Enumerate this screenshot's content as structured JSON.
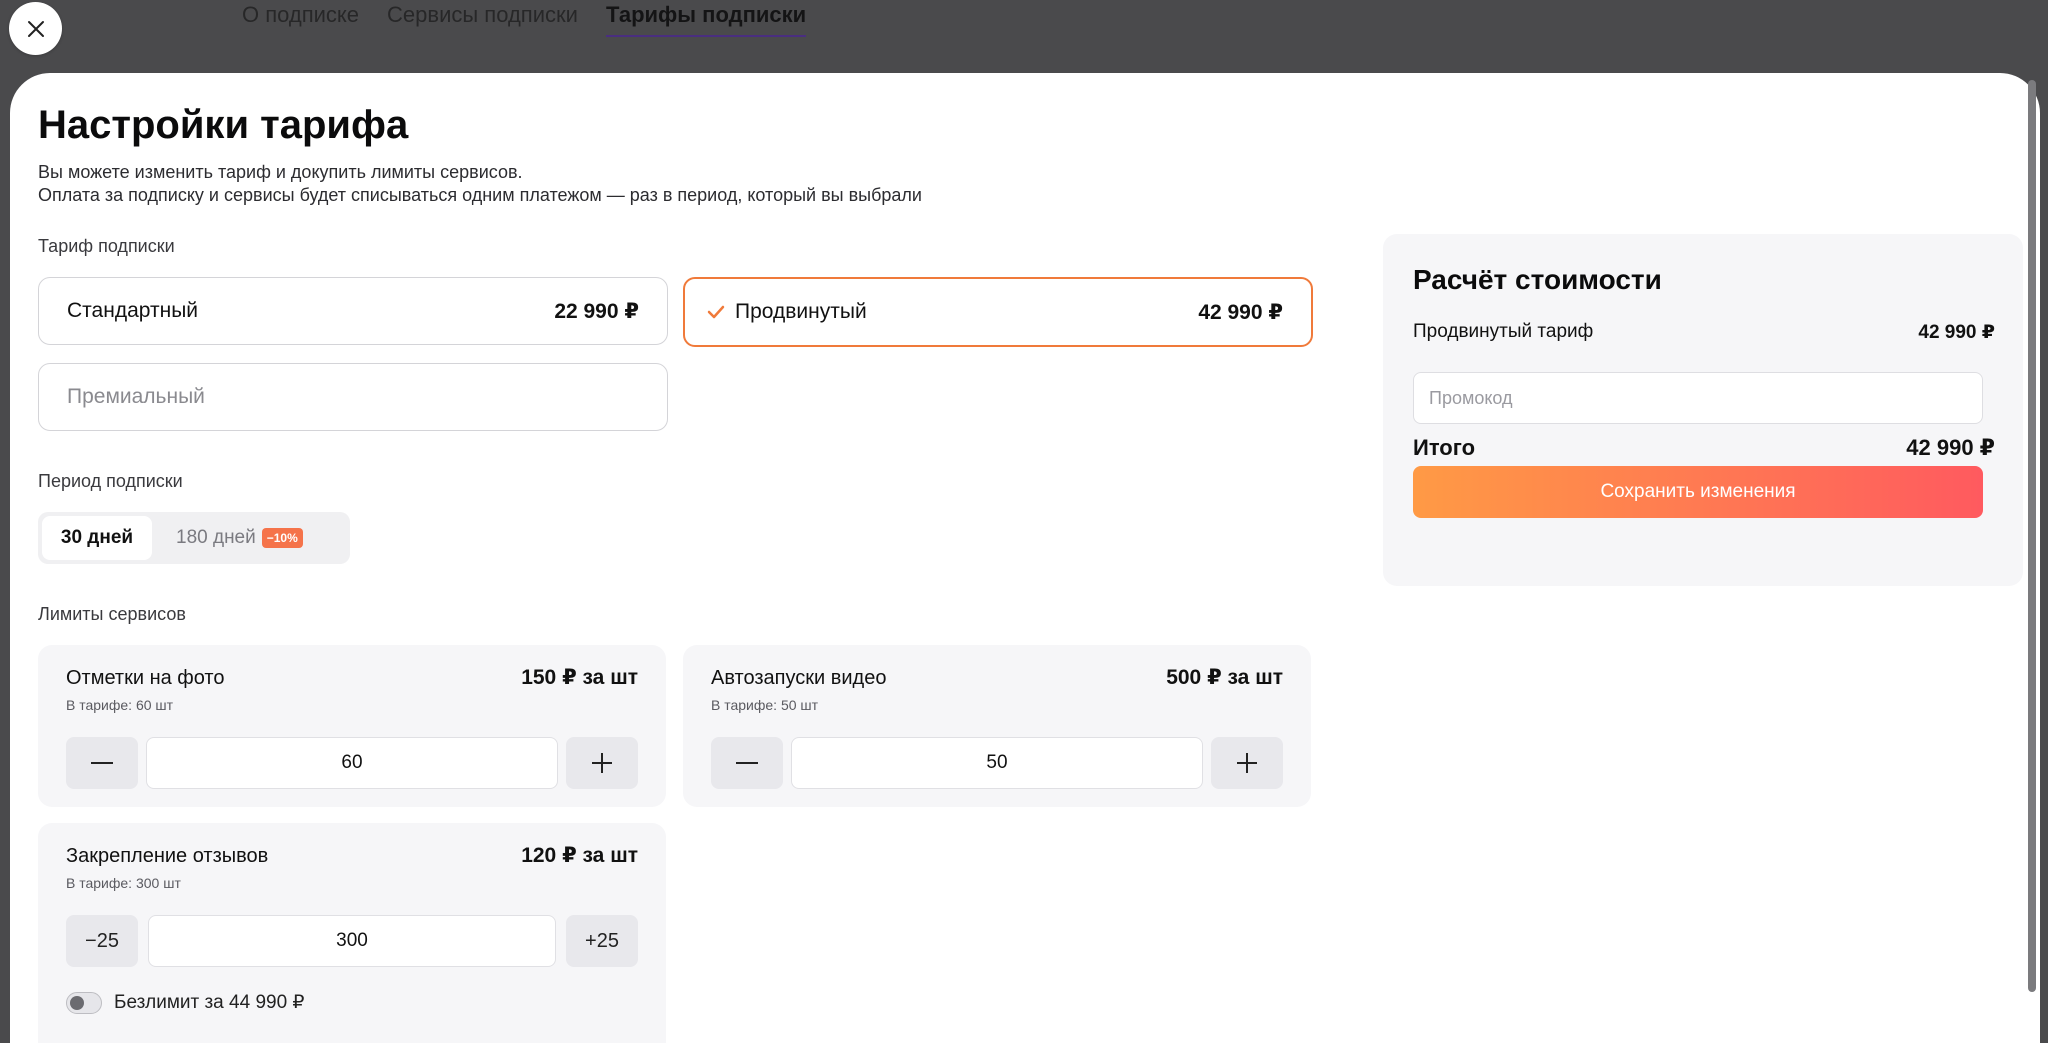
{
  "background": {
    "tabs": [
      {
        "label": "О подписке"
      },
      {
        "label": "Сервисы подписки"
      },
      {
        "label": "Тарифы подписки",
        "active": true
      }
    ]
  },
  "modal": {
    "title": "Настройки тарифа",
    "subtitle_line1": "Вы можете изменить тариф и докупить лимиты сервисов.",
    "subtitle_line2": "Оплата за подписку и сервисы будет списываться одним платежом — раз в период, который вы выбрали",
    "close_icon": "close-icon"
  },
  "tariff": {
    "label": "Тариф подписки",
    "options": [
      {
        "name": "Стандартный",
        "price": "22 990 ₽",
        "selected": false
      },
      {
        "name": "Продвинутый",
        "price": "42 990 ₽",
        "selected": true
      },
      {
        "name": "Премиальный",
        "price": "",
        "selected": false
      }
    ]
  },
  "period": {
    "label": "Период подписки",
    "options": [
      {
        "label": "30 дней",
        "selected": true
      },
      {
        "label": "180 дней",
        "badge": "−10%",
        "selected": false
      }
    ]
  },
  "limits": {
    "label": "Лимиты сервисов",
    "items": [
      {
        "title": "Отметки на фото",
        "price": "150 ₽ за шт",
        "included": "В тарифе: 60 шт",
        "value": "60",
        "minus": "−",
        "plus": "+"
      },
      {
        "title": "Автозапуски видео",
        "price": "500 ₽ за шт",
        "included": "В тарифе: 50 шт",
        "value": "50",
        "minus": "−",
        "plus": "+"
      },
      {
        "title": "Закрепление отзывов",
        "price": "120 ₽ за шт",
        "included": "В тарифе: 300 шт",
        "value": "300",
        "minus": "−25",
        "plus": "+25",
        "toggle_label": "Безлимит за 44 990 ₽",
        "toggle_on": false
      }
    ]
  },
  "cost": {
    "title": "Расчёт стоимости",
    "line_label": "Продвинутый тариф",
    "line_value": "42 990 ₽",
    "promo_placeholder": "Промокод",
    "total_label": "Итого",
    "total_value": "42 990 ₽",
    "save_label": "Сохранить изменения"
  },
  "colors": {
    "accent": "#f07a3a",
    "gradient_start": "#ff9a45",
    "gradient_end": "#ff5a5f",
    "badge": "#f5734a"
  }
}
